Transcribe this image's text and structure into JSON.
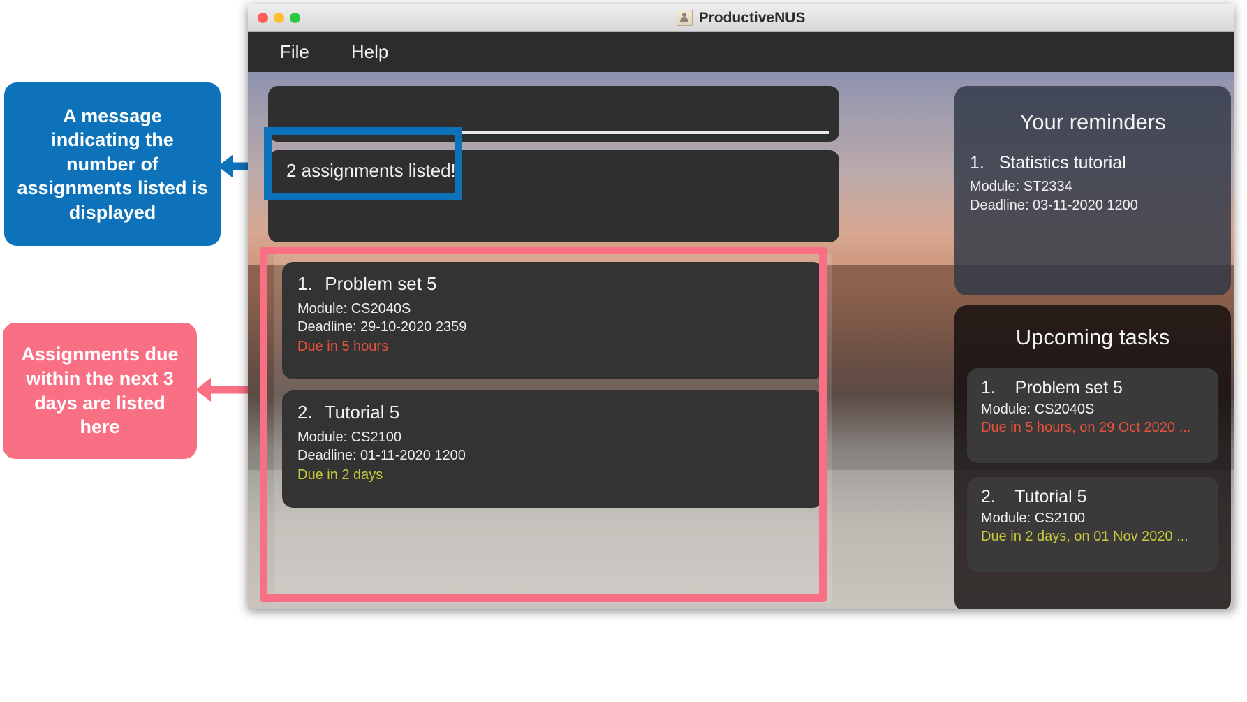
{
  "window": {
    "title": "ProductiveNUS",
    "title_icon": "person-icon",
    "traffic_lights": [
      "close",
      "minimize",
      "maximize"
    ]
  },
  "menubar": {
    "items": [
      {
        "label": "File"
      },
      {
        "label": "Help"
      }
    ]
  },
  "command": {
    "input_value": "",
    "placeholder": ""
  },
  "result": {
    "message": "2 assignments listed!"
  },
  "assignments": {
    "items": [
      {
        "index": "1.",
        "name": "Problem set 5",
        "module": "Module: CS2040S",
        "deadline": "Deadline: 29-10-2020 2359",
        "due": "Due in 5 hours",
        "due_color": "#e8523c"
      },
      {
        "index": "2.",
        "name": "Tutorial 5",
        "module": "Module: CS2100",
        "deadline": "Deadline: 01-11-2020 1200",
        "due": "Due in 2 days",
        "due_color": "#c9c93e"
      }
    ]
  },
  "reminders": {
    "heading": "Your reminders",
    "items": [
      {
        "index": "1.",
        "name": "Statistics tutorial",
        "module": "Module: ST2334",
        "deadline": "Deadline: 03-11-2020 1200"
      }
    ]
  },
  "upcoming": {
    "heading": "Upcoming tasks",
    "items": [
      {
        "index": "1.",
        "name": "Problem set 5",
        "module": "Module: CS2040S",
        "due": "Due in 5 hours, on 29 Oct 2020 ...",
        "due_color": "#e8523c"
      },
      {
        "index": "2.",
        "name": "Tutorial 5",
        "module": "Module: CS2100",
        "due": "Due in 2 days, on 01 Nov 2020 ...",
        "due_color": "#c9c93e"
      }
    ]
  },
  "annotations": {
    "blue": {
      "text": "A message indicating the number of assignments listed is displayed",
      "color": "#0d72b9"
    },
    "pink": {
      "text": "Assignments due within the next 3 days are listed here",
      "color": "#f97084"
    }
  }
}
